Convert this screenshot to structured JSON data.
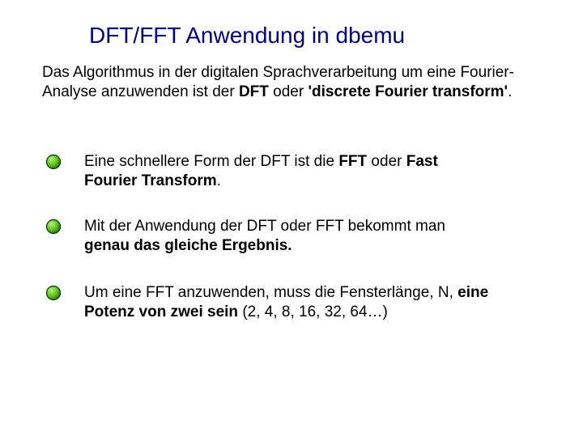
{
  "title": "DFT/FFT Anwendung in dbemu",
  "intro": {
    "p1": "Das Algorithmus in der digitalen Sprachverarbeitung um eine Fourier-Analyse anzuwenden ist der ",
    "p2_bold": "DFT",
    "p3": " oder ",
    "p4_bold": "'discrete Fourier transform'",
    "p5": "."
  },
  "bullets": [
    {
      "a": "Eine schnellere Form der DFT ist die ",
      "b_bold": "FFT",
      "c": " oder ",
      "d_bold": "Fast Fourier Transform",
      "e": "."
    },
    {
      "a": "Mit der Anwendung der DFT oder FFT bekommt man ",
      "b_bold": "genau das gleiche Ergebnis.",
      "c": "",
      "d_bold": "",
      "e": ""
    },
    {
      "a": "Um eine FFT anzuwenden, muss die Fensterlänge, N, ",
      "b_bold": "eine Potenz von zwei sein",
      "c": " (2, 4, 8, 16, 32, 64…)",
      "d_bold": "",
      "e": ""
    }
  ],
  "colors": {
    "title": "#000080",
    "bullet_fill": "#66cc00",
    "bullet_stroke": "#003300"
  }
}
